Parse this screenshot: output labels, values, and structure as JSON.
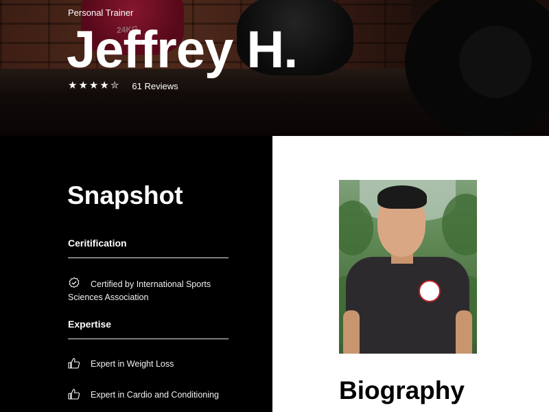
{
  "hero": {
    "role": "Personal Trainer",
    "name": "Jeffrey H.",
    "rating": 4.5,
    "reviews": "61 Reviews",
    "kettlebell_label": "24KG"
  },
  "snapshot": {
    "title": "Snapshot",
    "certification_heading": "Ceritification",
    "certifications": [
      "Certified by International Sports Sciences Association"
    ],
    "expertise_heading": "Expertise",
    "expertise": [
      "Expert in Weight Loss",
      "Expert in Cardio and Conditioning"
    ]
  },
  "profile": {
    "biography_title": "Biography"
  },
  "icons": {
    "certification": "check-badge-icon",
    "expertise": "thumbs-up-icon",
    "stars": "star-icon"
  },
  "colors": {
    "panel_dark": "#000000",
    "panel_light": "#ffffff",
    "text_light": "#ffffff",
    "text_dark": "#000000"
  }
}
